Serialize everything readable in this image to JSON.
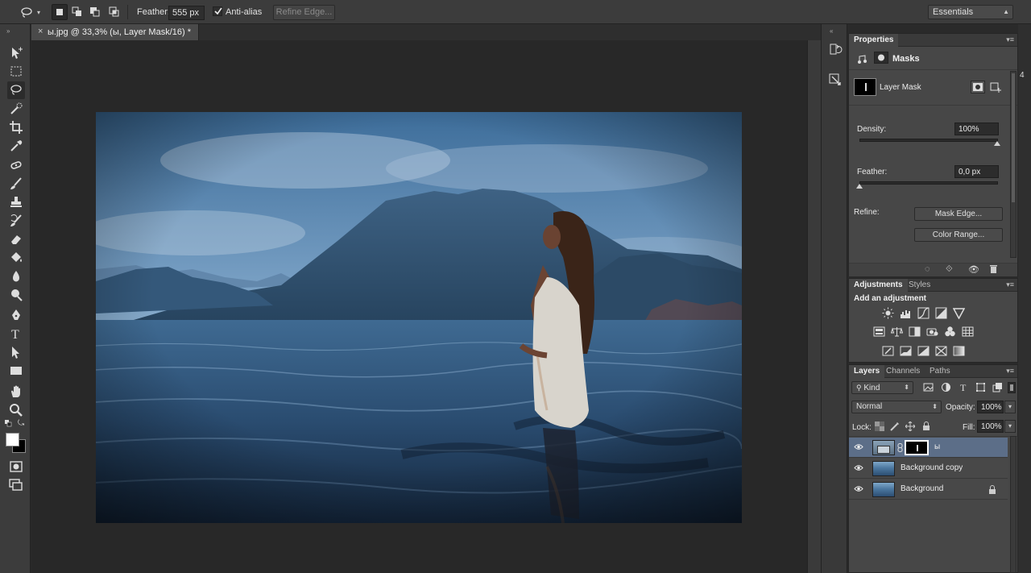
{
  "options_bar": {
    "feather_label": "Feather:",
    "feather_value": "555 px",
    "antialias_label": "Anti-alias",
    "antialias_checked": true,
    "refine_edge_label": "Refine Edge...",
    "workspace_value": "Essentials"
  },
  "document": {
    "tab_close": "×",
    "tab_title": "ы.jpg @ 33,3% (ы, Layer Mask/16) *"
  },
  "properties": {
    "tab": "Properties",
    "header": "Masks",
    "layer_mask_label": "Layer Mask",
    "density_label": "Density:",
    "density_value": "100%",
    "feather_label": "Feather:",
    "feather_value": "0,0 px",
    "refine_label": "Refine:",
    "mask_edge_button": "Mask Edge...",
    "color_range_button": "Color Range..."
  },
  "adjustments": {
    "tabs": [
      "Adjustments",
      "Styles"
    ],
    "title": "Add an adjustment"
  },
  "layers_panel": {
    "tabs": [
      "Layers",
      "Channels",
      "Paths"
    ],
    "filter_kind": "Kind",
    "blend_mode": "Normal",
    "opacity_label": "Opacity:",
    "opacity_value": "100%",
    "lock_label": "Lock:",
    "fill_label": "Fill:",
    "fill_value": "100%",
    "layers": [
      {
        "name": "ы",
        "selected": true,
        "has_mask": true
      },
      {
        "name": "Background copy",
        "selected": false
      },
      {
        "name": "Background",
        "selected": false,
        "locked": true
      }
    ]
  },
  "colors": {
    "panel_bg": "#474747",
    "selected_layer": "#5c6e88",
    "canvas_bg": "#282828"
  },
  "edge_text": "4"
}
